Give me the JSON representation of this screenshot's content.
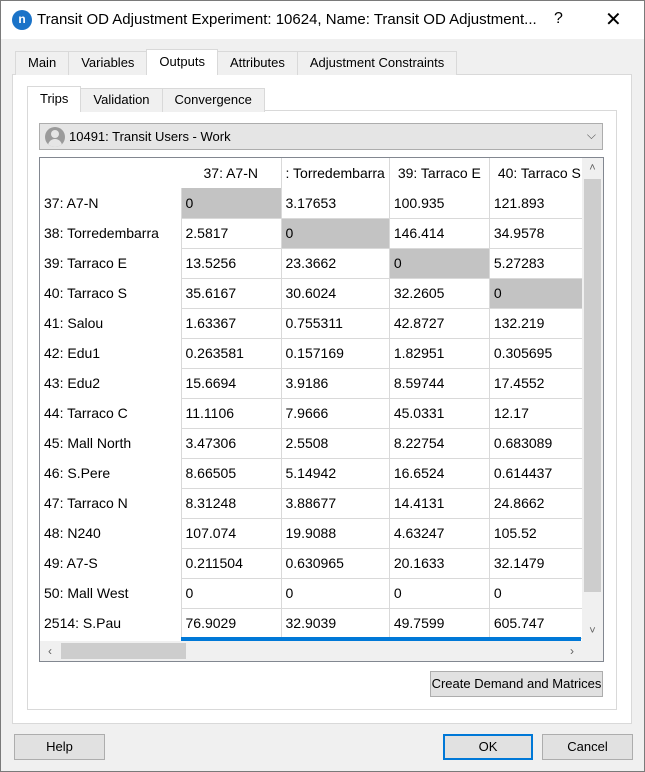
{
  "window": {
    "title": "Transit OD Adjustment Experiment: 10624, Name: Transit OD Adjustment...",
    "app_icon_glyph": "n",
    "help_glyph": "?",
    "close_glyph": "✕"
  },
  "main_tabs": [
    {
      "label": "Main",
      "active": false
    },
    {
      "label": "Variables",
      "active": false
    },
    {
      "label": "Outputs",
      "active": true
    },
    {
      "label": "Attributes",
      "active": false
    },
    {
      "label": "Adjustment Constraints",
      "active": false
    }
  ],
  "sub_tabs": [
    {
      "label": "Trips",
      "active": true
    },
    {
      "label": "Validation",
      "active": false
    },
    {
      "label": "Convergence",
      "active": false
    }
  ],
  "matrix_selector": {
    "icon": "user-icon",
    "value": "10491: Transit Users - Work",
    "arrow": "⌵"
  },
  "grid": {
    "columns": [
      "37: A7-N",
      ": Torredembarra",
      "39: Tarraco E",
      "40: Tarraco S"
    ],
    "rows": [
      {
        "label": "37: A7-N",
        "values": [
          "0",
          "3.17653",
          "100.935",
          "121.893"
        ],
        "diag": 0
      },
      {
        "label": "38: Torredembarra",
        "values": [
          "2.5817",
          "0",
          "146.414",
          "34.9578"
        ],
        "diag": 1
      },
      {
        "label": "39: Tarraco E",
        "values": [
          "13.5256",
          "23.3662",
          "0",
          "5.27283"
        ],
        "diag": 2
      },
      {
        "label": "40: Tarraco S",
        "values": [
          "35.6167",
          "30.6024",
          "32.2605",
          "0"
        ],
        "diag": 3
      },
      {
        "label": "41: Salou",
        "values": [
          "1.63367",
          "0.755311",
          "42.8727",
          "132.219"
        ],
        "diag": -1
      },
      {
        "label": "42: Edu1",
        "values": [
          "0.263581",
          "0.157169",
          "1.82951",
          "0.305695"
        ],
        "diag": -1
      },
      {
        "label": "43: Edu2",
        "values": [
          "15.6694",
          "3.9186",
          "8.59744",
          "17.4552"
        ],
        "diag": -1
      },
      {
        "label": "44: Tarraco C",
        "values": [
          "11.1106",
          "7.9666",
          "45.0331",
          "12.17"
        ],
        "diag": -1
      },
      {
        "label": "45: Mall North",
        "values": [
          "3.47306",
          "2.5508",
          "8.22754",
          "0.683089"
        ],
        "diag": -1
      },
      {
        "label": "46: S.Pere",
        "values": [
          "8.66505",
          "5.14942",
          "16.6524",
          "0.614437"
        ],
        "diag": -1
      },
      {
        "label": "47: Tarraco N",
        "values": [
          "8.31248",
          "3.88677",
          "14.4131",
          "24.8662"
        ],
        "diag": -1
      },
      {
        "label": "48: N240",
        "values": [
          "107.074",
          "19.9088",
          "4.63247",
          "105.52"
        ],
        "diag": -1
      },
      {
        "label": "49: A7-S",
        "values": [
          "0.211504",
          "0.630965",
          "20.1633",
          "32.1479"
        ],
        "diag": -1
      },
      {
        "label": "50: Mall West",
        "values": [
          "0",
          "0",
          "0",
          "0"
        ],
        "diag": -1
      },
      {
        "label": "2514: S.Pau",
        "values": [
          "76.9029",
          "32.9039",
          "49.7599",
          "605.747"
        ],
        "diag": -1
      }
    ],
    "scroll": {
      "up": "˄",
      "down": "˅",
      "left": "‹",
      "right": "›"
    }
  },
  "buttons": {
    "create": "Create Demand and Matrices",
    "help": "Help",
    "ok": "OK",
    "cancel": "Cancel"
  }
}
